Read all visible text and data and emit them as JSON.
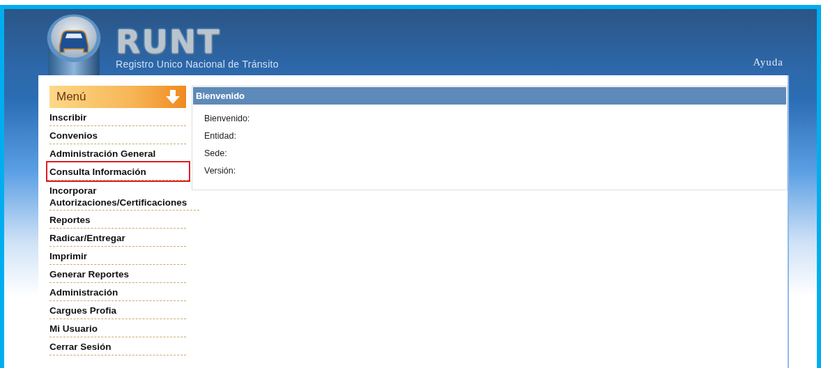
{
  "header": {
    "logo": "RUNT",
    "subtitle": "Registro Unico Nacional de Tránsito",
    "help_link": "Ayuda"
  },
  "menu": {
    "title": "Menú",
    "items": [
      {
        "label": "Inscribir",
        "highlighted": false
      },
      {
        "label": "Convenios",
        "highlighted": false
      },
      {
        "label": "Administración General",
        "highlighted": false
      },
      {
        "label": "Consulta Información",
        "highlighted": true
      },
      {
        "label": "Incorporar Autorizaciones/Certificaciones",
        "highlighted": false
      },
      {
        "label": "Reportes",
        "highlighted": false
      },
      {
        "label": "Radicar/Entregar",
        "highlighted": false
      },
      {
        "label": "Imprimir",
        "highlighted": false
      },
      {
        "label": "Generar Reportes",
        "highlighted": false
      },
      {
        "label": "Administración",
        "highlighted": false
      },
      {
        "label": "Cargues Profia",
        "highlighted": false
      },
      {
        "label": "Mi Usuario",
        "highlighted": false
      },
      {
        "label": "Cerrar Sesión",
        "highlighted": false
      }
    ]
  },
  "welcome_panel": {
    "title": "Bienvenido",
    "fields": [
      "Bienvenido:",
      "Entidad:",
      "Sede:",
      "Versión:"
    ]
  }
}
